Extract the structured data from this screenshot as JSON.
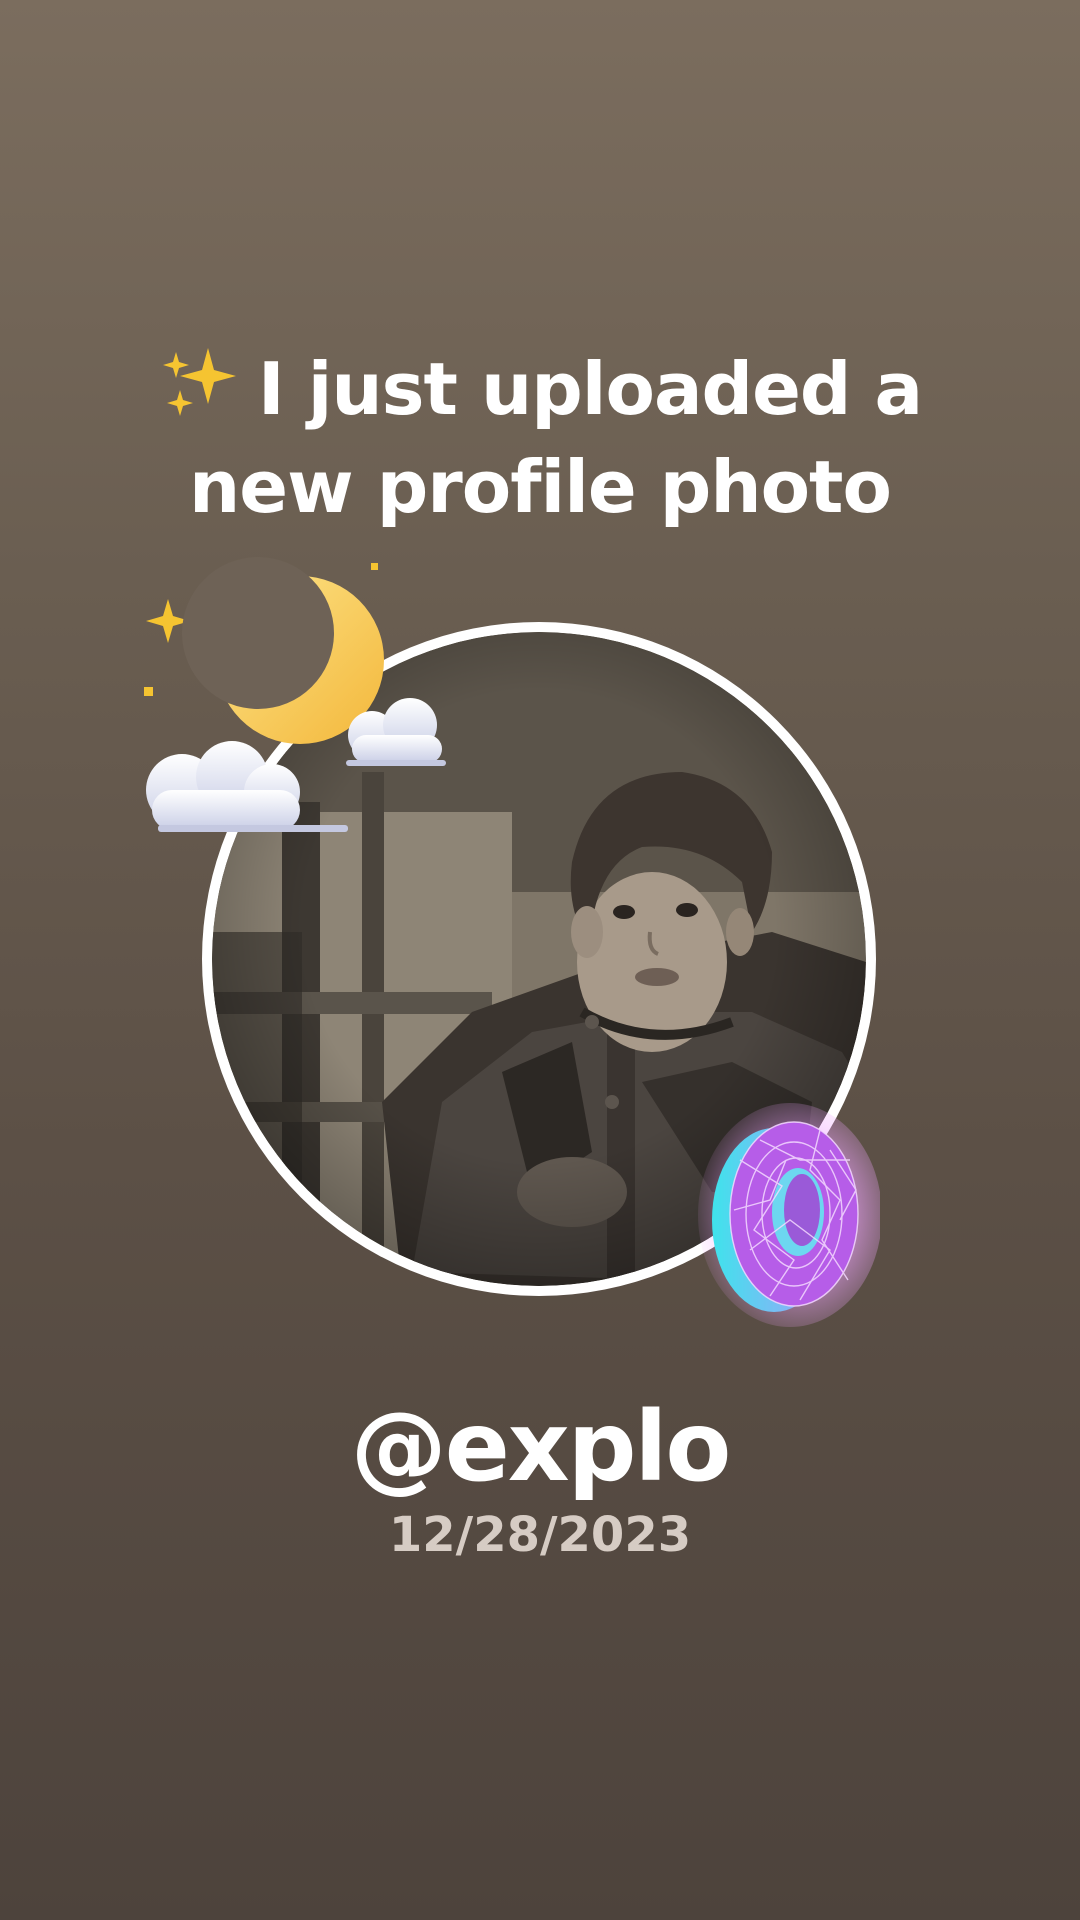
{
  "story": {
    "headline_line1": "I just uploaded a",
    "headline_line2": "new profile photo",
    "username": "@explo",
    "date": "12/28/2023",
    "headline_emoji": "sparkles-icon",
    "stickers": [
      "moon-clouds-sticker",
      "wireframe-donut-sticker"
    ]
  },
  "colors": {
    "background_top": "#7b6d5e",
    "background_bottom": "#4d433c",
    "text": "#ffffff",
    "date_text": "#d6ccc4",
    "photo_ring": "#ffffff"
  }
}
